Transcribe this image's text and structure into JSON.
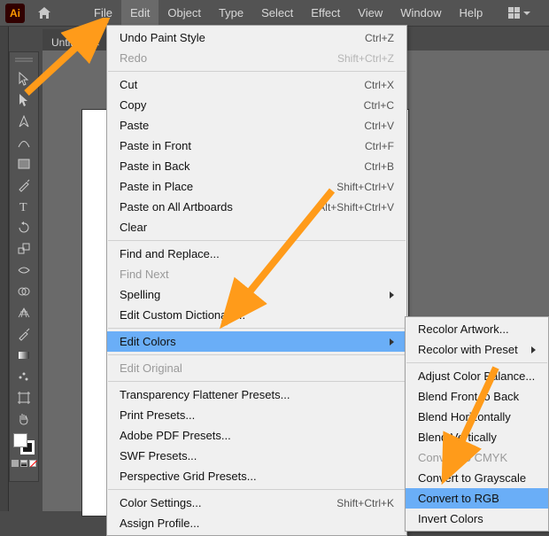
{
  "logo": "Ai",
  "menubar": [
    "File",
    "Edit",
    "Object",
    "Type",
    "Select",
    "Effect",
    "View",
    "Window",
    "Help"
  ],
  "tab": {
    "title": "Untitled",
    "close": "×"
  },
  "edit_menu": {
    "groups": [
      [
        {
          "label": "Undo Paint Style",
          "shortcut": "Ctrl+Z",
          "enabled": true
        },
        {
          "label": "Redo",
          "shortcut": "Shift+Ctrl+Z",
          "enabled": false
        }
      ],
      [
        {
          "label": "Cut",
          "shortcut": "Ctrl+X",
          "enabled": true
        },
        {
          "label": "Copy",
          "shortcut": "Ctrl+C",
          "enabled": true
        },
        {
          "label": "Paste",
          "shortcut": "Ctrl+V",
          "enabled": true
        },
        {
          "label": "Paste in Front",
          "shortcut": "Ctrl+F",
          "enabled": true
        },
        {
          "label": "Paste in Back",
          "shortcut": "Ctrl+B",
          "enabled": true
        },
        {
          "label": "Paste in Place",
          "shortcut": "Shift+Ctrl+V",
          "enabled": true
        },
        {
          "label": "Paste on All Artboards",
          "shortcut": "Alt+Shift+Ctrl+V",
          "enabled": true
        },
        {
          "label": "Clear",
          "shortcut": "",
          "enabled": true
        }
      ],
      [
        {
          "label": "Find and Replace...",
          "shortcut": "",
          "enabled": true
        },
        {
          "label": "Find Next",
          "shortcut": "",
          "enabled": false
        },
        {
          "label": "Spelling",
          "shortcut": "",
          "enabled": true,
          "submenu": true
        },
        {
          "label": "Edit Custom Dictionary...",
          "shortcut": "",
          "enabled": true
        }
      ],
      [
        {
          "label": "Edit Colors",
          "shortcut": "",
          "enabled": true,
          "submenu": true,
          "highlight": true
        }
      ],
      [
        {
          "label": "Edit Original",
          "shortcut": "",
          "enabled": false
        }
      ],
      [
        {
          "label": "Transparency Flattener Presets...",
          "shortcut": "",
          "enabled": true
        },
        {
          "label": "Print Presets...",
          "shortcut": "",
          "enabled": true
        },
        {
          "label": "Adobe PDF Presets...",
          "shortcut": "",
          "enabled": true
        },
        {
          "label": "SWF Presets...",
          "shortcut": "",
          "enabled": true
        },
        {
          "label": "Perspective Grid Presets...",
          "shortcut": "",
          "enabled": true
        }
      ],
      [
        {
          "label": "Color Settings...",
          "shortcut": "Shift+Ctrl+K",
          "enabled": true
        },
        {
          "label": "Assign Profile...",
          "shortcut": "",
          "enabled": true
        }
      ]
    ]
  },
  "colors_submenu": {
    "groups": [
      [
        {
          "label": "Recolor Artwork...",
          "enabled": true
        },
        {
          "label": "Recolor with Preset",
          "enabled": true,
          "submenu": true
        }
      ],
      [
        {
          "label": "Adjust Color Balance...",
          "enabled": true
        },
        {
          "label": "Blend Front to Back",
          "enabled": true
        },
        {
          "label": "Blend Horizontally",
          "enabled": true
        },
        {
          "label": "Blend Vertically",
          "enabled": true
        },
        {
          "label": "Convert to CMYK",
          "enabled": false
        },
        {
          "label": "Convert to Grayscale",
          "enabled": true
        },
        {
          "label": "Convert to RGB",
          "enabled": true,
          "highlight": true
        },
        {
          "label": "Invert Colors",
          "enabled": true
        }
      ]
    ]
  },
  "tools": [
    "selection-tool",
    "direct-selection-tool",
    "pen-tool",
    "curvature-tool",
    "rectangle-tool",
    "paintbrush-tool",
    "type-tool",
    "rotate-tool",
    "scale-tool",
    "width-tool",
    "shape-builder-tool",
    "perspective-grid-tool",
    "eyedropper-tool",
    "gradient-tool",
    "symbol-sprayer-tool",
    "artboard-tool",
    "hand-tool"
  ]
}
